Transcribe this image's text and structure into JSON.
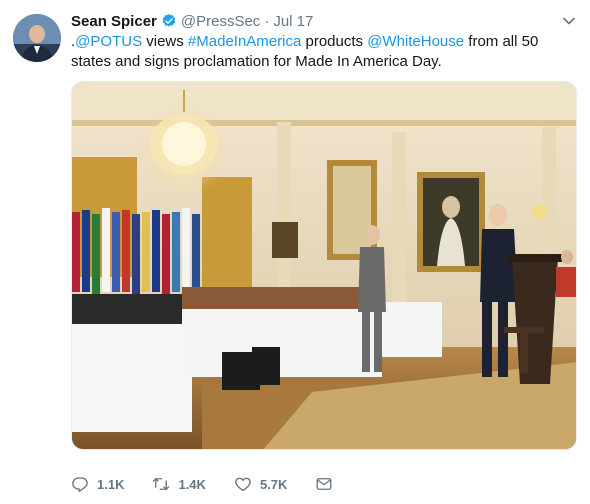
{
  "tweet": {
    "author_name": "Sean Spicer",
    "handle": "@PressSec",
    "separator": "·",
    "timestamp": "Jul 17",
    "text_parts": [
      {
        "text": ".",
        "type": "plain"
      },
      {
        "text": "@POTUS",
        "type": "link"
      },
      {
        "text": " views ",
        "type": "plain"
      },
      {
        "text": "#MadeInAmerica",
        "type": "link"
      },
      {
        "text": " products ",
        "type": "plain"
      },
      {
        "text": "@WhiteHouse",
        "type": "link"
      },
      {
        "text": " from all 50 states and signs proclamation for Made In America Day.",
        "type": "plain"
      }
    ]
  },
  "actions": {
    "reply_count": "1.1K",
    "retweet_count": "1.4K",
    "like_count": "5.7K"
  },
  "icons": {
    "verified": "verified-badge-icon",
    "more": "chevron-down-icon",
    "reply": "reply-icon",
    "retweet": "retweet-icon",
    "like": "heart-icon",
    "dm": "envelope-icon"
  },
  "colors": {
    "link": "#1b95e0",
    "secondary_text": "#657786",
    "verified": "#1da1f2"
  }
}
